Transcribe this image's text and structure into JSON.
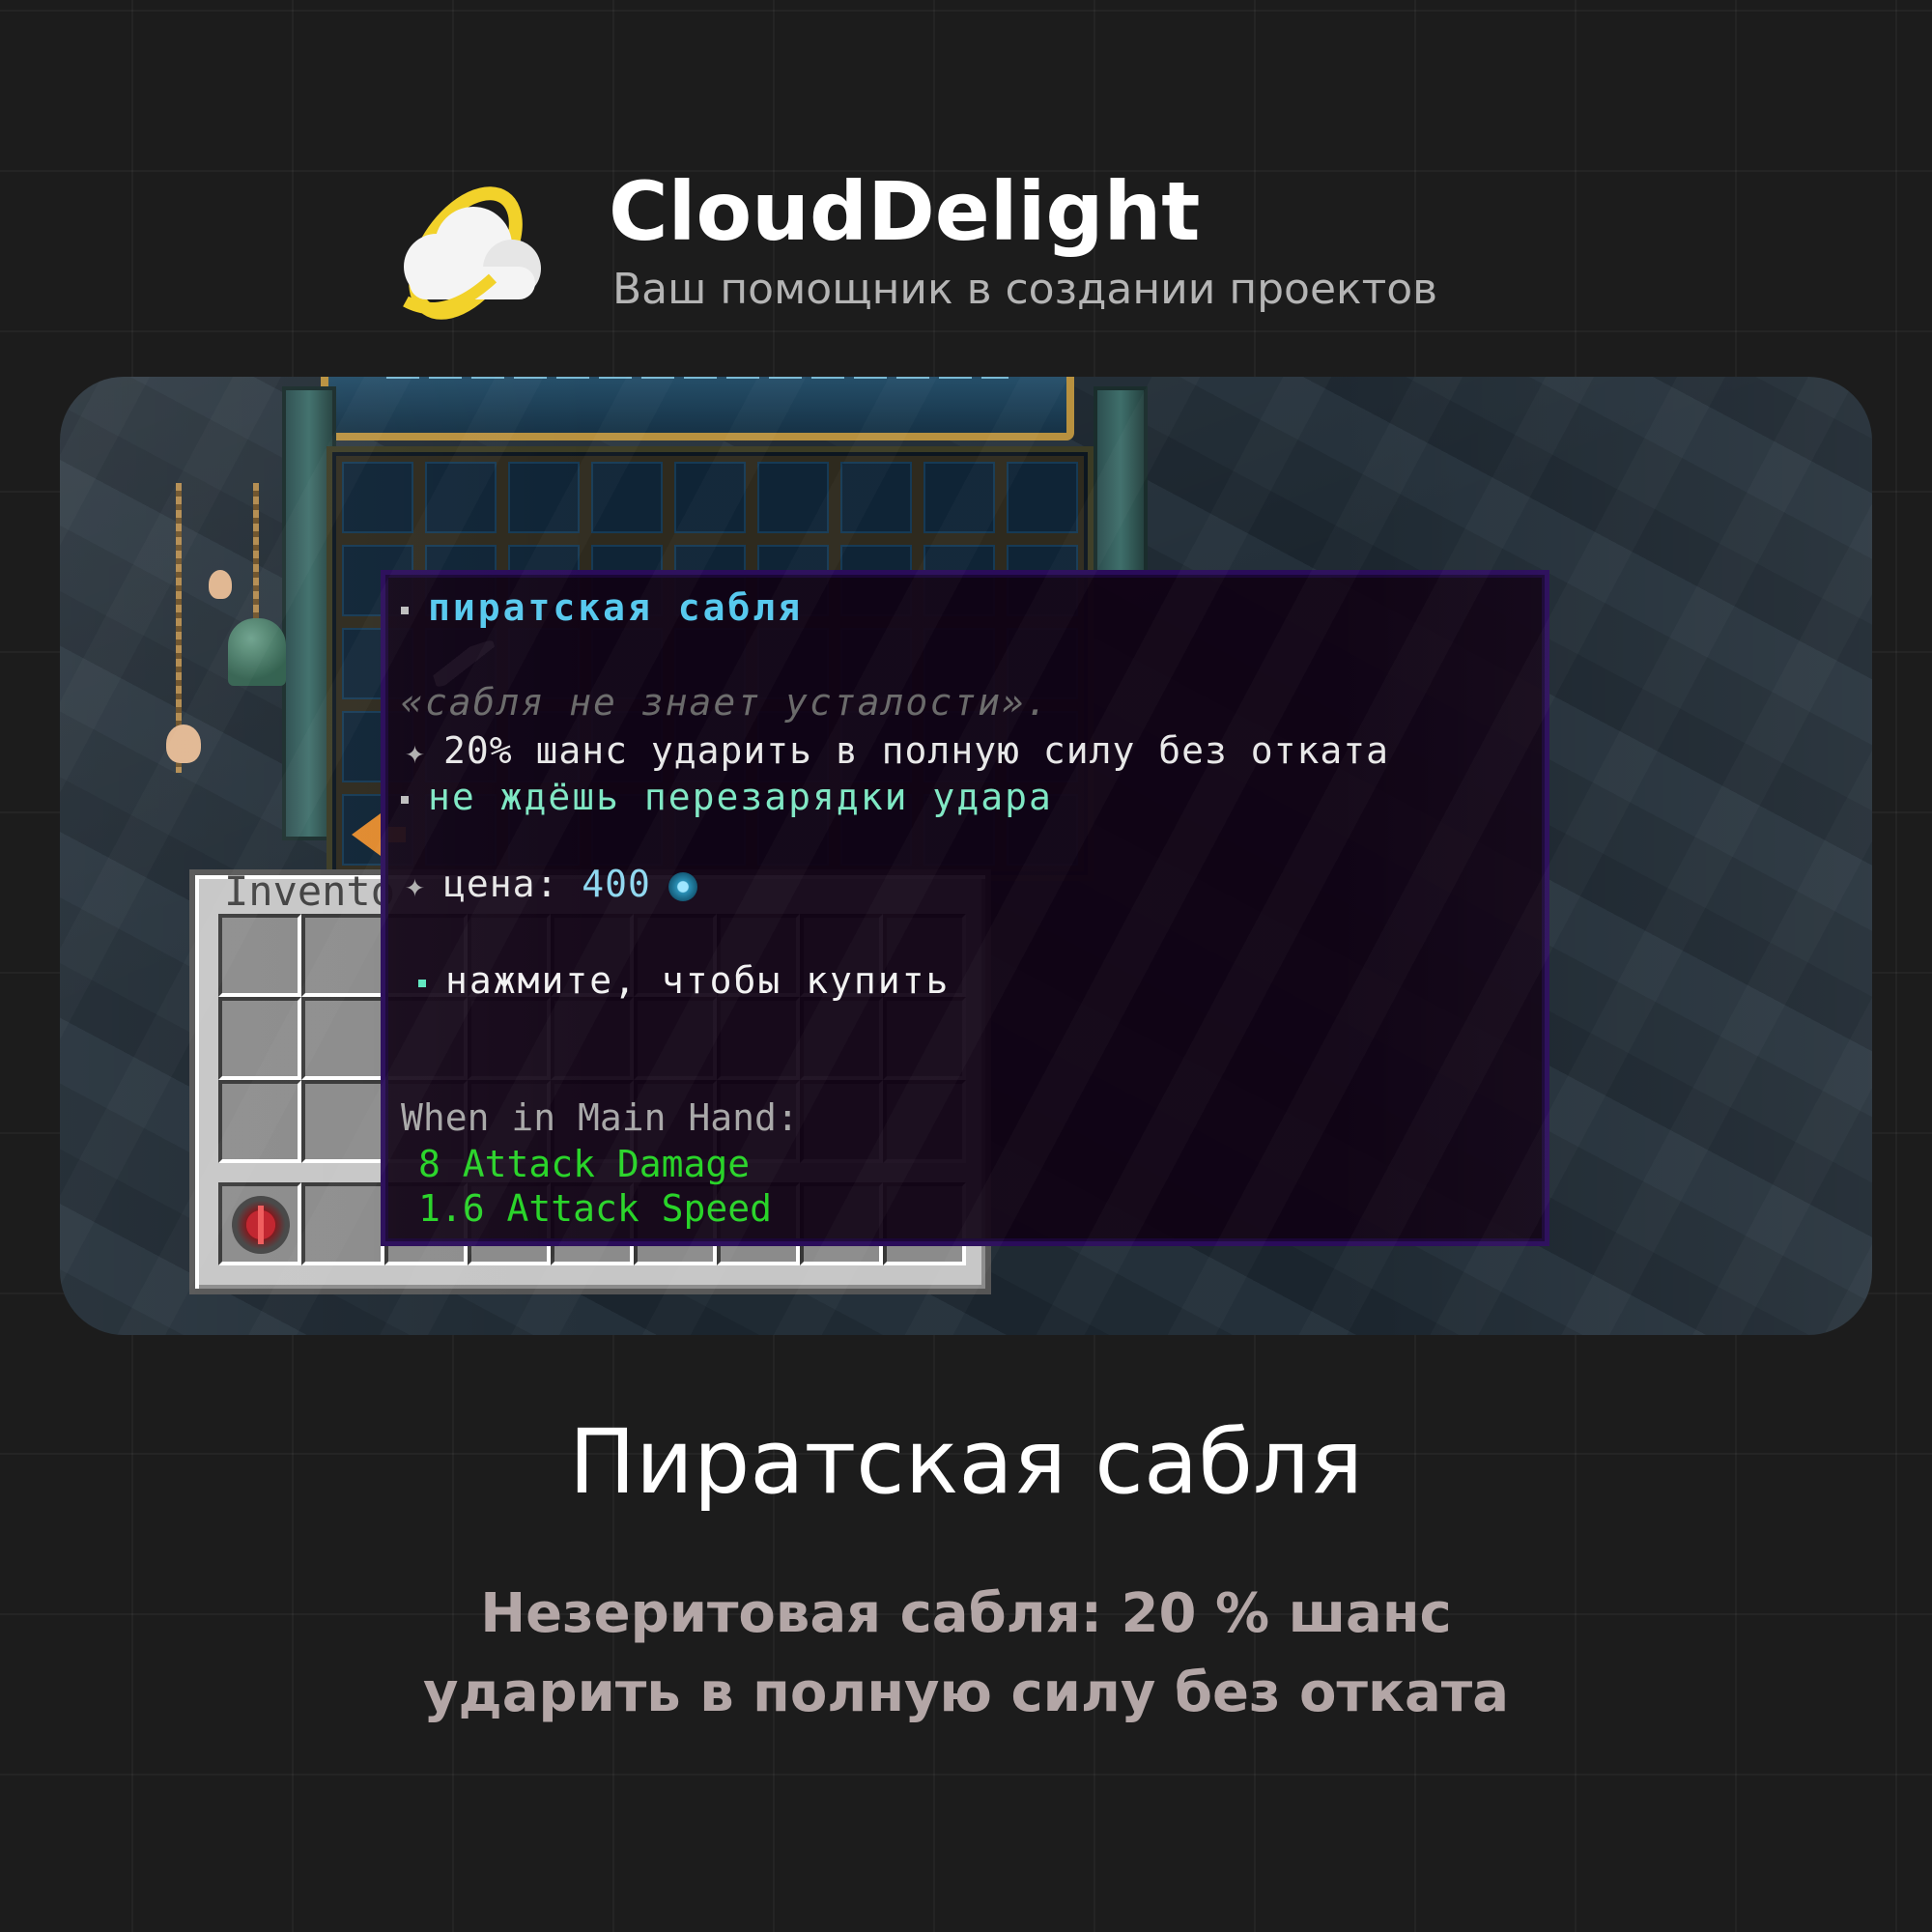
{
  "brand": {
    "name": "CloudDelight",
    "tagline": "Ваш помощник в создании проектов",
    "colors": {
      "ring": "#f2d22a",
      "cloud": "#f4f4f4"
    }
  },
  "shop_gui": {
    "inventory_title": "Invento",
    "chest_item_icons": [
      "saber-icon",
      "back-arrow-icon"
    ],
    "hotbar_item_icons": [
      "compass-icon"
    ]
  },
  "tooltip": {
    "title": "пиратская сабля",
    "lore": "«сабля не знает усталости».",
    "chance_line": "20% шанс ударить в полную силу без отката",
    "no_cooldown_line": "не ждёшь перезарядки удара",
    "price_label": "цена:",
    "price_value": "400",
    "buy_hint": "нажмите, чтобы купить",
    "main_hand_label": "When in Main Hand:",
    "attack_damage": "8 Attack Damage",
    "attack_speed": "1.6 Attack Speed",
    "colors": {
      "title": "#57c9ee",
      "stat": "#29d429",
      "border": "#2a0c5a"
    }
  },
  "item": {
    "title": "Пиратская сабля",
    "description_line1": "Незеритовая сабля: 20 % шанс",
    "description_line2": "ударить в полную силу без отката"
  }
}
